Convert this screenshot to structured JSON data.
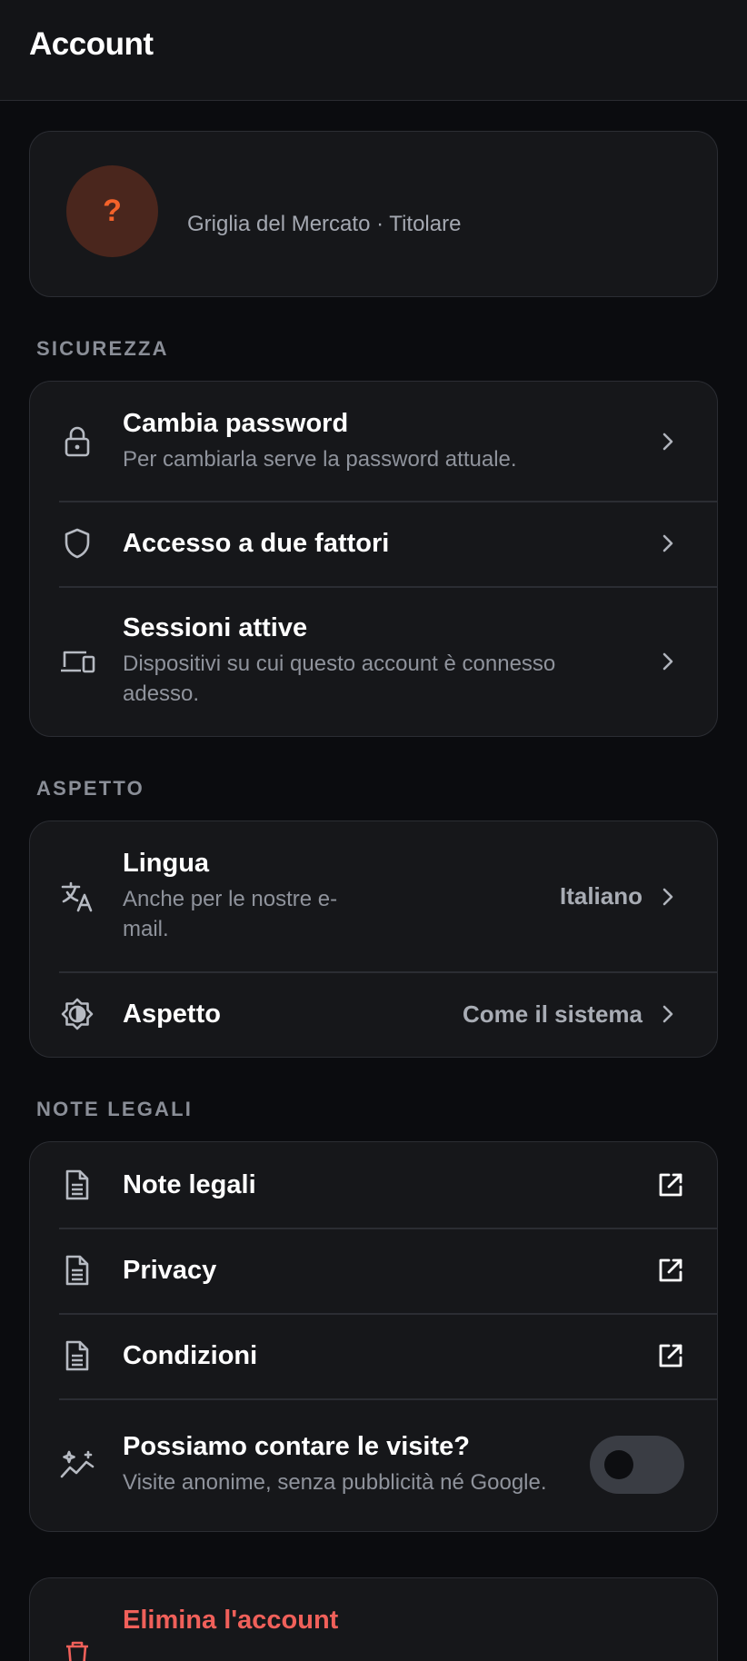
{
  "header": {
    "title": "Account"
  },
  "profile": {
    "avatar_glyph": "?",
    "subtitle": "Griglia del Mercato · Titolare"
  },
  "sections": {
    "security": {
      "label": "SICUREZZA",
      "items": [
        {
          "title": "Cambia password",
          "desc": "Per cambiarla serve la password attuale.",
          "icon": "lock-icon"
        },
        {
          "title": "Accesso a due fattori",
          "icon": "shield-icon"
        },
        {
          "title": "Sessioni attive",
          "desc": "Dispositivi su cui questo account è connesso adesso.",
          "icon": "devices-icon"
        }
      ]
    },
    "appearance": {
      "label": "ASPETTO",
      "items": [
        {
          "title": "Lingua",
          "desc": "Anche per le nostre e-mail.",
          "value": "Italiano",
          "icon": "translate-icon"
        },
        {
          "title": "Aspetto",
          "value": "Come il sistema",
          "icon": "brightness-icon"
        }
      ]
    },
    "legal": {
      "label": "NOTE LEGALI",
      "items": [
        {
          "title": "Note legali",
          "icon": "document-icon"
        },
        {
          "title": "Privacy",
          "icon": "document-icon"
        },
        {
          "title": "Condizioni",
          "icon": "document-icon"
        }
      ],
      "analytics": {
        "title": "Possiamo contare le visite?",
        "desc": "Visite anonime, senza pubblicità né Google.",
        "enabled": false
      }
    }
  },
  "danger": {
    "title": "Elimina l'account"
  },
  "colors": {
    "background": "#0b0c0f",
    "card": "#16171a",
    "accent_orange": "#f4622a",
    "danger": "#f0605a"
  }
}
